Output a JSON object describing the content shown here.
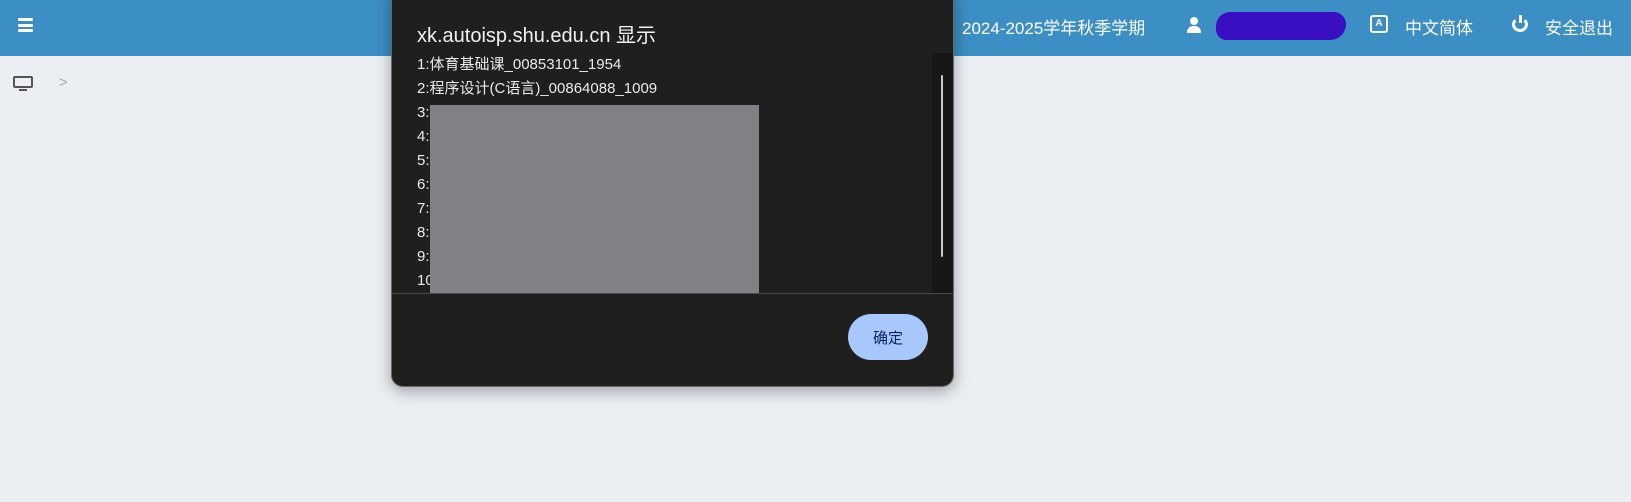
{
  "topbar": {
    "menu_icon": "hamburger-menu-icon",
    "term": "2024-2025学年秋季学期",
    "user_icon": "user-icon",
    "language_icon": "translate-icon",
    "language": "中文简体",
    "logout_icon": "power-icon",
    "logout": "安全退出",
    "background": "#3b8fc4"
  },
  "breadcrumb": {
    "home_icon": "monitor-icon",
    "separator": ">"
  },
  "dialog": {
    "title": "xk.autoisp.shu.edu.cn 显示",
    "lines": [
      "1:体育基础课_00853101_1954",
      "2:程序设计(C语言)_00864088_1009",
      "3:",
      "4:",
      "5:",
      "6:",
      "7:",
      "8:",
      "9:",
      "10"
    ],
    "ok_label": "确定",
    "ok_color": "#a8c7fa"
  }
}
